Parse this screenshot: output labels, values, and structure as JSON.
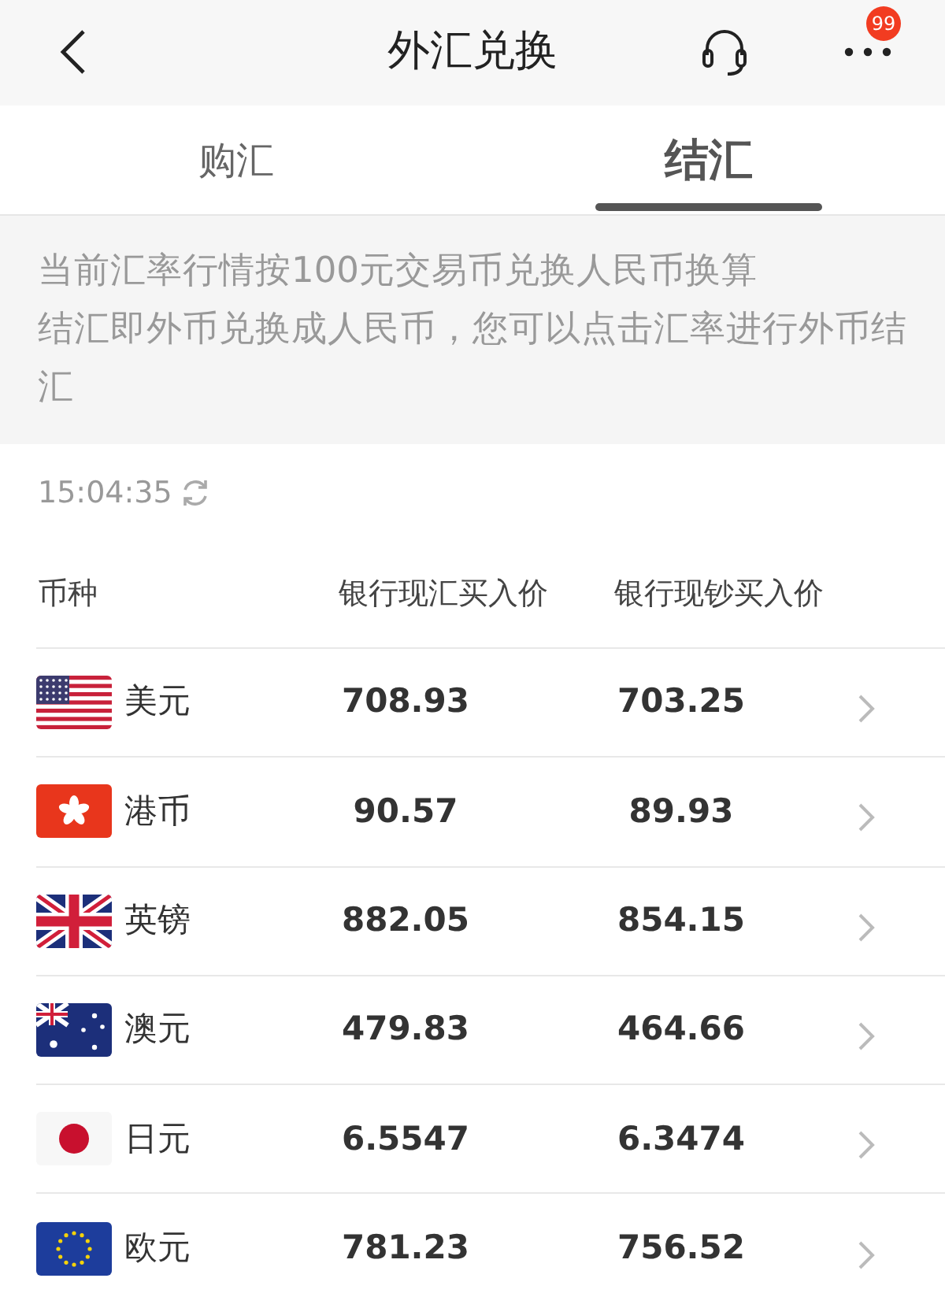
{
  "header": {
    "title": "外汇兑换",
    "badge": "99"
  },
  "tabs": [
    {
      "label": "购汇",
      "selected": false
    },
    {
      "label": "结汇",
      "selected": true
    }
  ],
  "notice": [
    "当前汇率行情按100元交易币兑换人民币换算",
    "结汇即外币兑换成人民币，您可以点击汇率进行外币结汇"
  ],
  "updated_time": "15:04:35",
  "table": {
    "columns": [
      "币种",
      "银行现汇买入价",
      "银行现钞买入价"
    ],
    "rows": [
      {
        "currency": "美元",
        "spot_rate": "708.93",
        "cash_rate": "703.25"
      },
      {
        "currency": "港币",
        "spot_rate": "90.57",
        "cash_rate": "89.93"
      },
      {
        "currency": "英镑",
        "spot_rate": "882.05",
        "cash_rate": "854.15"
      },
      {
        "currency": "澳元",
        "spot_rate": "479.83",
        "cash_rate": "464.66"
      },
      {
        "currency": "日元",
        "spot_rate": "6.5547",
        "cash_rate": "6.3474"
      },
      {
        "currency": "欧元",
        "spot_rate": "781.23",
        "cash_rate": "756.52"
      }
    ]
  }
}
